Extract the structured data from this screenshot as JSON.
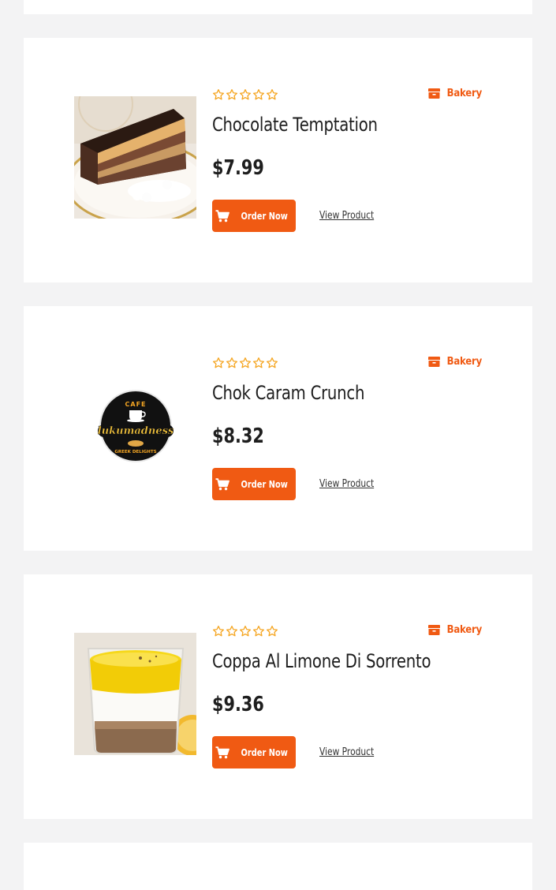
{
  "products": [
    {
      "title": "Chocolate Temptation",
      "price": "$7.99",
      "category": "Bakery",
      "rating": 0,
      "max_rating": 5,
      "order_label": "Order Now",
      "view_label": "View Product",
      "image": "chocolate-layer-cake-slice"
    },
    {
      "title": "Chok Caram Crunch",
      "price": "$8.32",
      "category": "Bakery",
      "rating": 0,
      "max_rating": 5,
      "order_label": "Order Now",
      "view_label": "View Product",
      "image": "lukumadness-cafe-logo",
      "logo": {
        "top": "CAFE",
        "name": "lukumadness",
        "bottom": "GREEK DELIGHTS"
      }
    },
    {
      "title": "Coppa Al Limone Di Sorrento",
      "price": "$9.36",
      "category": "Bakery",
      "rating": 0,
      "max_rating": 5,
      "order_label": "Order Now",
      "view_label": "View Product",
      "image": "lemon-cream-cup-dessert"
    }
  ],
  "icons": {
    "star": "star-outline-icon",
    "category": "box-icon",
    "cart": "cart-icon"
  },
  "colors": {
    "accent": "#f05a13",
    "star": "#f5a623",
    "text": "#1e1e1e",
    "background": "#f3f3f4",
    "card": "#ffffff"
  }
}
